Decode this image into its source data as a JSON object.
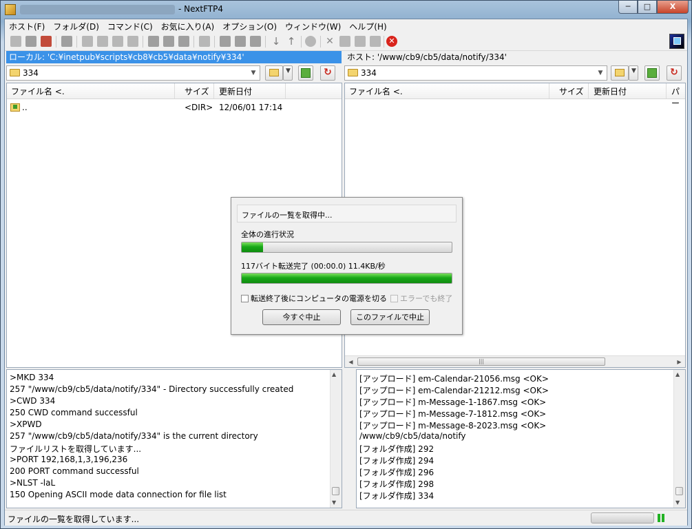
{
  "window": {
    "title": "- NextFTP4",
    "buttons": {
      "minimize": "─",
      "maximize": "□",
      "close": "X"
    }
  },
  "menu": [
    "ホスト(F)",
    "フォルダ(D)",
    "コマンド(C)",
    "お気に入り(A)",
    "オプション(O)",
    "ウィンドウ(W)",
    "ヘルプ(H)"
  ],
  "local": {
    "header": "ローカル: 'C:¥inetpub¥scripts¥cb8¥cb5¥data¥notify¥334'",
    "path": "334",
    "columns": {
      "name": "ファイル名 <.",
      "size": "サイズ",
      "date": "更新日付"
    },
    "rows": [
      {
        "name": "..",
        "size": "<DIR>",
        "date": "12/06/01 17:14"
      }
    ]
  },
  "remote": {
    "header": "ホスト: '/www/cb9/cb5/data/notify/334'",
    "path": "334",
    "columns": {
      "name": "ファイル名 <.",
      "size": "サイズ",
      "date": "更新日付",
      "perm": "パー"
    },
    "rows": []
  },
  "log_left": [
    ">MKD 334",
    "257 \"/www/cb9/cb5/data/notify/334\" - Directory successfully created",
    ">CWD 334",
    "250 CWD command successful",
    ">XPWD",
    "257 \"/www/cb9/cb5/data/notify/334\" is the current directory",
    "ファイルリストを取得しています...",
    ">PORT 192,168,1,3,196,236",
    "200 PORT command successful",
    ">NLST -laL",
    "150 Opening ASCII mode data connection for file list"
  ],
  "log_right": [
    "[アップロード] em-Calendar-21056.msg <OK>",
    "[アップロード] em-Calendar-21212.msg <OK>",
    "[アップロード] m-Message-1-1867.msg <OK>",
    "[アップロード] m-Message-7-1812.msg <OK>",
    "[アップロード] m-Message-8-2023.msg <OK>",
    "/www/cb9/cb5/data/notify",
    "[フォルダ作成] 292",
    "[フォルダ作成] 294",
    "[フォルダ作成] 296",
    "[フォルダ作成] 298",
    "[フォルダ作成] 334"
  ],
  "status": {
    "text": "ファイルの一覧を取得しています..."
  },
  "dialog": {
    "heading": "ファイルの一覧を取得中...",
    "overall_label": "全体の進行状況",
    "overall_progress": 0.1,
    "transfer_label": "117バイト転送完了 (00:00.0) 11.4KB/秒",
    "transfer_progress": 1.0,
    "shutdown_checkbox": "転送終了後にコンピュータの電源を切る",
    "error_checkbox": "エラーでも終了",
    "stop_now_button": "今すぐ中止",
    "stop_after_file_button": "このファイルで中止"
  },
  "colors": {
    "selection": "#3b92e8",
    "progress": "#18a818",
    "stop": "#d9241c"
  }
}
